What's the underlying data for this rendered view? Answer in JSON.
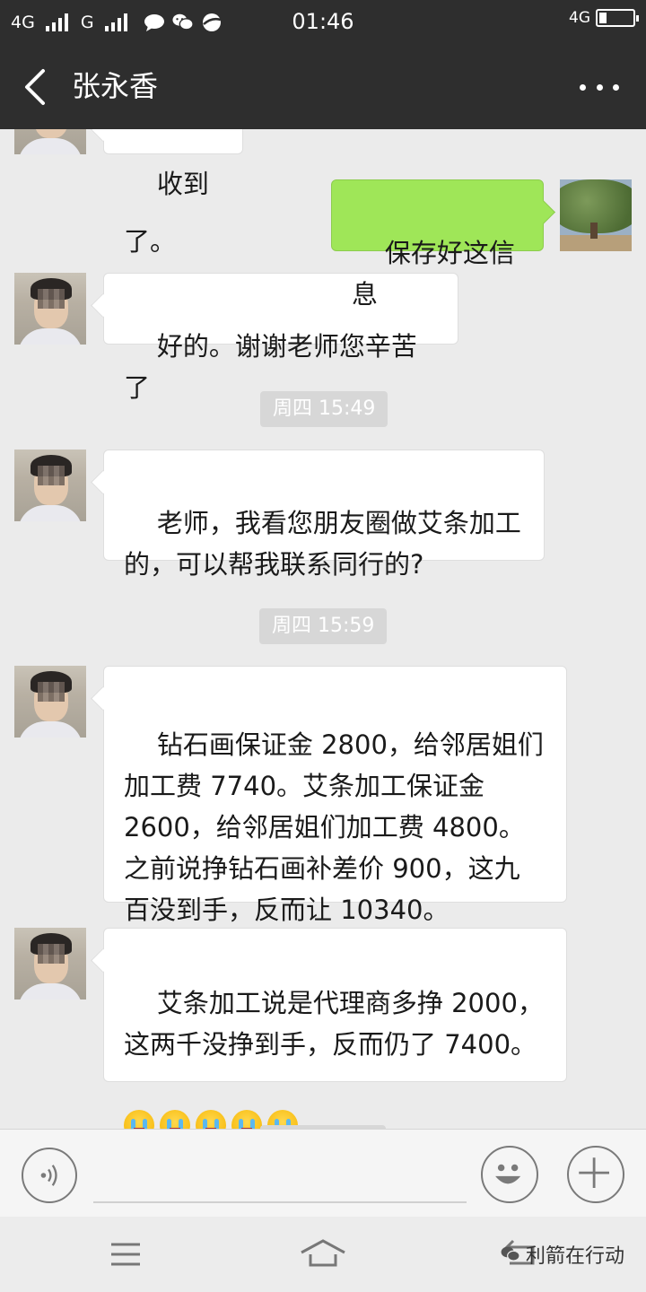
{
  "status_bar": {
    "network_1": "4G",
    "network_2": "G",
    "time": "01:46",
    "network_right": "4G",
    "icons": [
      "signal-icon",
      "chat-bubble-icon",
      "wechat-icon",
      "browser-icon",
      "battery-icon"
    ]
  },
  "header": {
    "title": "张永香",
    "back_icon": "chevron-left-icon",
    "more_icon": "more-dots-icon"
  },
  "messages": [
    {
      "side": "left",
      "text": "收到了。",
      "partial": true
    },
    {
      "side": "right",
      "text": "保存好这信息"
    },
    {
      "side": "left",
      "text": "好的。谢谢老师您辛苦了"
    },
    {
      "type": "time",
      "text": "周四 15:49"
    },
    {
      "side": "left",
      "text": "老师，我看您朋友圈做艾条加工\n的，可以帮我联系同行的?"
    },
    {
      "type": "time",
      "text": "周四 15:59"
    },
    {
      "side": "left",
      "text": "钻石画保证金 2800，给邻居姐们\n加工费 7740。艾条加工保证金\n2600，给邻居姐们加工费 4800。\n之前说挣钻石画补差价 900，这九\n百没到手，反而让 10340。"
    },
    {
      "side": "left",
      "text": "艾条加工说是代理商多挣 2000，\n这两千没挣到手，反而仍了 7400。",
      "emoji": [
        "crying-face-icon",
        "crying-face-icon",
        "crying-face-icon",
        "crying-face-icon",
        "crying-face-icon"
      ]
    }
  ],
  "input_bar": {
    "voice_icon": "voice-input-icon",
    "emoji_icon": "emoji-icon",
    "plus_icon": "plus-icon"
  },
  "nav_bar": {
    "icons": [
      "menu-icon",
      "home-icon",
      "back-nav-icon"
    ],
    "watermark": "利箭在行动"
  },
  "colors": {
    "header_bg": "#2e2e2e",
    "chat_bg": "#ebebeb",
    "bubble_self": "#9fe658",
    "bubble_other": "#ffffff"
  }
}
